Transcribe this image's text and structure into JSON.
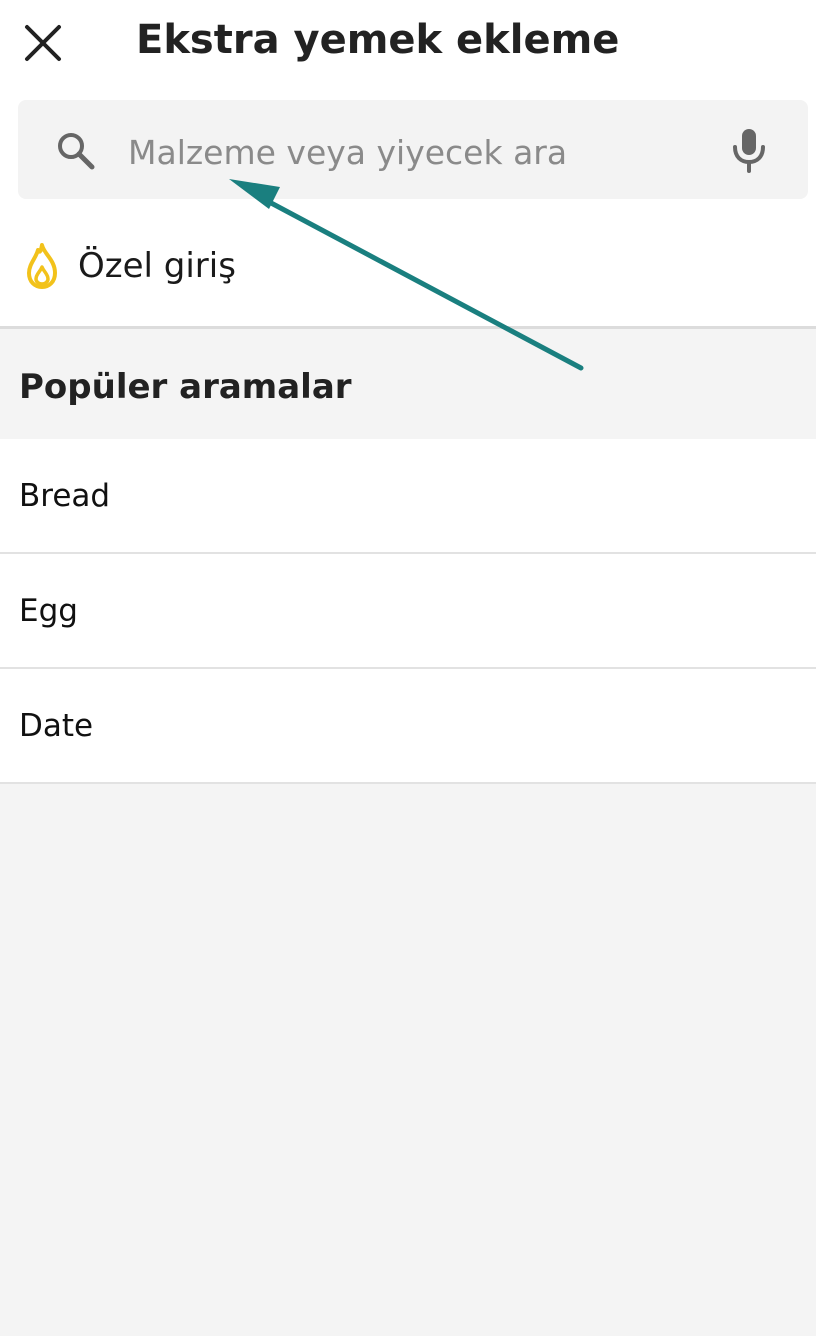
{
  "header": {
    "title": "Ekstra yemek ekleme",
    "close_icon": "close-icon"
  },
  "search": {
    "placeholder": "Malzeme veya yiyecek ara",
    "value": "",
    "search_icon": "search-icon",
    "mic_icon": "microphone-icon"
  },
  "custom_entry": {
    "label": "Özel giriş",
    "icon": "flame-icon",
    "icon_color": "#f2c21b"
  },
  "popular": {
    "title": "Popüler aramalar",
    "items": [
      {
        "label": "Bread"
      },
      {
        "label": "Egg"
      },
      {
        "label": "Date"
      }
    ]
  },
  "annotation": {
    "arrow_color": "#1a7f7f"
  },
  "colors": {
    "background": "#f4f4f4",
    "surface": "#ffffff",
    "search_background": "#f3f3f3",
    "placeholder_text": "#8a8a8a"
  }
}
